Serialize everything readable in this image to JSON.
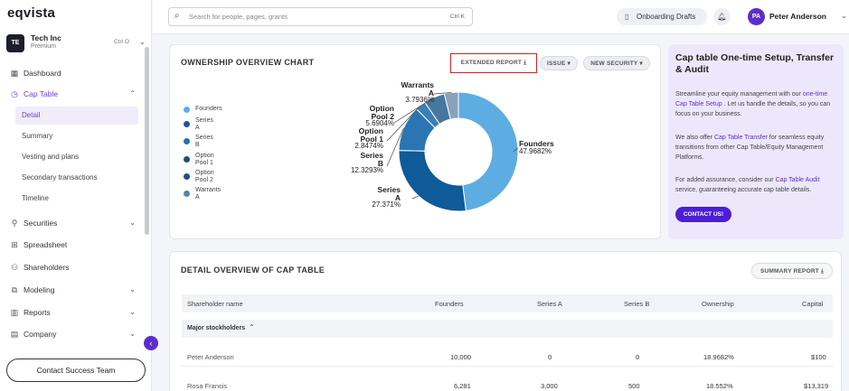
{
  "app": {
    "logo": "eqvista"
  },
  "company": {
    "initials": "TE",
    "name": "Tech Inc",
    "plan": "Premium",
    "shortcut": "Ctrl O"
  },
  "sidebar": {
    "items": [
      {
        "label": "Dashboard"
      },
      {
        "label": "Cap Table"
      },
      {
        "label": "Securities"
      },
      {
        "label": "Spreadsheet"
      },
      {
        "label": "Shareholders"
      },
      {
        "label": "Modeling"
      },
      {
        "label": "Reports"
      },
      {
        "label": "Company"
      }
    ],
    "cap_table_sub": [
      "Detail",
      "Summary",
      "Vesting and plans",
      "Secondary transactions",
      "Timeline"
    ],
    "contact_button": "Contact Success Team"
  },
  "header": {
    "search_placeholder": "Search for people, pages, grants",
    "search_shortcut": "Ctrl K",
    "drafts_label": "Onboarding Drafts",
    "user_initials": "PA",
    "user_name": "Peter Anderson"
  },
  "ownership": {
    "title": "OWNERSHIP OVERVIEW CHART",
    "extended_report": "EXTENDED REPORT",
    "issue": "ISSUE",
    "new_security": "NEW SECURITY",
    "legend": [
      {
        "line1": "Founders",
        "line2": "",
        "color": "#5dade2"
      },
      {
        "line1": "Series",
        "line2": "A",
        "color": "#1a5a9a"
      },
      {
        "line1": "Series",
        "line2": "B",
        "color": "#2e6fa8"
      },
      {
        "line1": "Option",
        "line2": "Pool 1",
        "color": "#1f4e79"
      },
      {
        "line1": "Option",
        "line2": "Pool 2",
        "color": "#1b4f8a"
      },
      {
        "line1": "Warrants",
        "line2": "A",
        "color": "#4f86b0"
      }
    ]
  },
  "chart_data": {
    "type": "pie",
    "categories": [
      "Founders",
      "Series A",
      "Series B",
      "Option Pool 1",
      "Option Pool 2",
      "Warrants A"
    ],
    "values": [
      47.9682,
      27.371,
      12.3293,
      2.8474,
      5.6904,
      3.7936
    ],
    "label_lines": [
      [
        "Founders",
        ""
      ],
      [
        "Series",
        "A"
      ],
      [
        "Series",
        "B"
      ],
      [
        "Option",
        "Pool 1"
      ],
      [
        "Option",
        "Pool 2"
      ],
      [
        "Warrants",
        "A"
      ]
    ],
    "value_labels": [
      "47.9682%",
      "27.371%",
      "12.3293%",
      "2.8474%",
      "5.6904%",
      "3.7936%"
    ],
    "colors": [
      "#5dade2",
      "#0f5a99",
      "#2b76b2",
      "#3a7fb5",
      "#46779f",
      "#8aa2b8"
    ],
    "legend": "left"
  },
  "setup": {
    "title": "Cap table One-time Setup, Transfer & Audit",
    "p1_a": "Streamline your equity management with our ",
    "p1_link": "one-time Cap Table Setup",
    "p1_b": " . Let us handle the details, so you can focus on your business.",
    "p2_a": "We also offer ",
    "p2_link": "Cap Table Transfer",
    "p2_b": " for seamless equity transitions from other Cap Table/Equity Management Platforms.",
    "p3_a": "For added assurance, consider our ",
    "p3_link": "Cap Table Audit",
    "p3_b": " service, guaranteeing accurate cap table details.",
    "button": "CONTACT US!"
  },
  "detail": {
    "title": "DETAIL OVERVIEW OF CAP TABLE",
    "summary_report": "SUMMARY REPORT",
    "columns": [
      "Shareholder name",
      "Founders",
      "Series A",
      "Series B",
      "Ownership",
      "Capital"
    ],
    "group_label": "Major stockholders",
    "rows": [
      {
        "name": "Peter Anderson",
        "founders": "10,000",
        "series_a": "0",
        "series_b": "0",
        "ownership": "18.9682%",
        "capital": "$100"
      },
      {
        "name": "Rosa Francis",
        "founders": "6,281",
        "series_a": "3,000",
        "series_b": "500",
        "ownership": "18.552%",
        "capital": "$13,319"
      }
    ]
  }
}
